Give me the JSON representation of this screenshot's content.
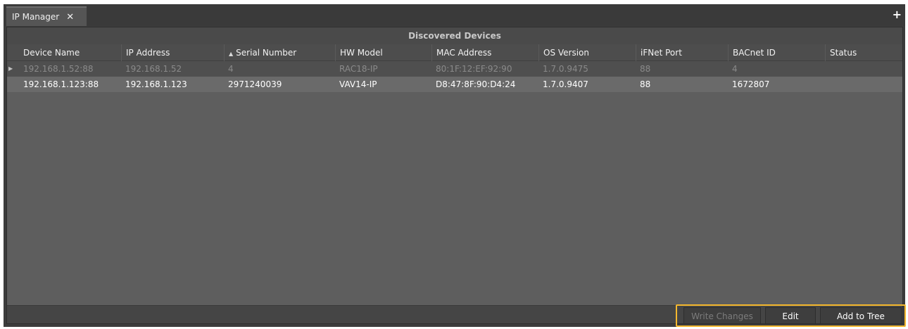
{
  "tab": {
    "label": "IP Manager",
    "close": "✕"
  },
  "toolbar": {
    "add": "+"
  },
  "panel": {
    "title": "Discovered Devices"
  },
  "table": {
    "columns": [
      "Device Name",
      "IP Address",
      "Serial Number",
      "HW Model",
      "MAC Address",
      "OS Version",
      "iFNet Port",
      "BACnet ID",
      "Status"
    ],
    "sort_indicator": "▲",
    "row_indicator": "▶",
    "rows": [
      [
        "192.168.1.52:88",
        "192.168.1.52",
        "4",
        "RAC18-IP",
        "80:1F:12:EF:92:90",
        "1.7.0.9475",
        "88",
        "4",
        ""
      ],
      [
        "192.168.1.123:88",
        "192.168.1.123",
        "2971240039",
        "VAV14-IP",
        "D8:47:8F:90:D4:24",
        "1.7.0.9407",
        "88",
        "1672807",
        ""
      ]
    ]
  },
  "buttons": {
    "write_changes": "Write Changes",
    "edit": "Edit",
    "add_to_tree": "Add to Tree"
  },
  "colors": {
    "highlight": "#f5b82e",
    "panel_bg": "#5e5e5e",
    "selected_row": "#6a6a6a"
  }
}
